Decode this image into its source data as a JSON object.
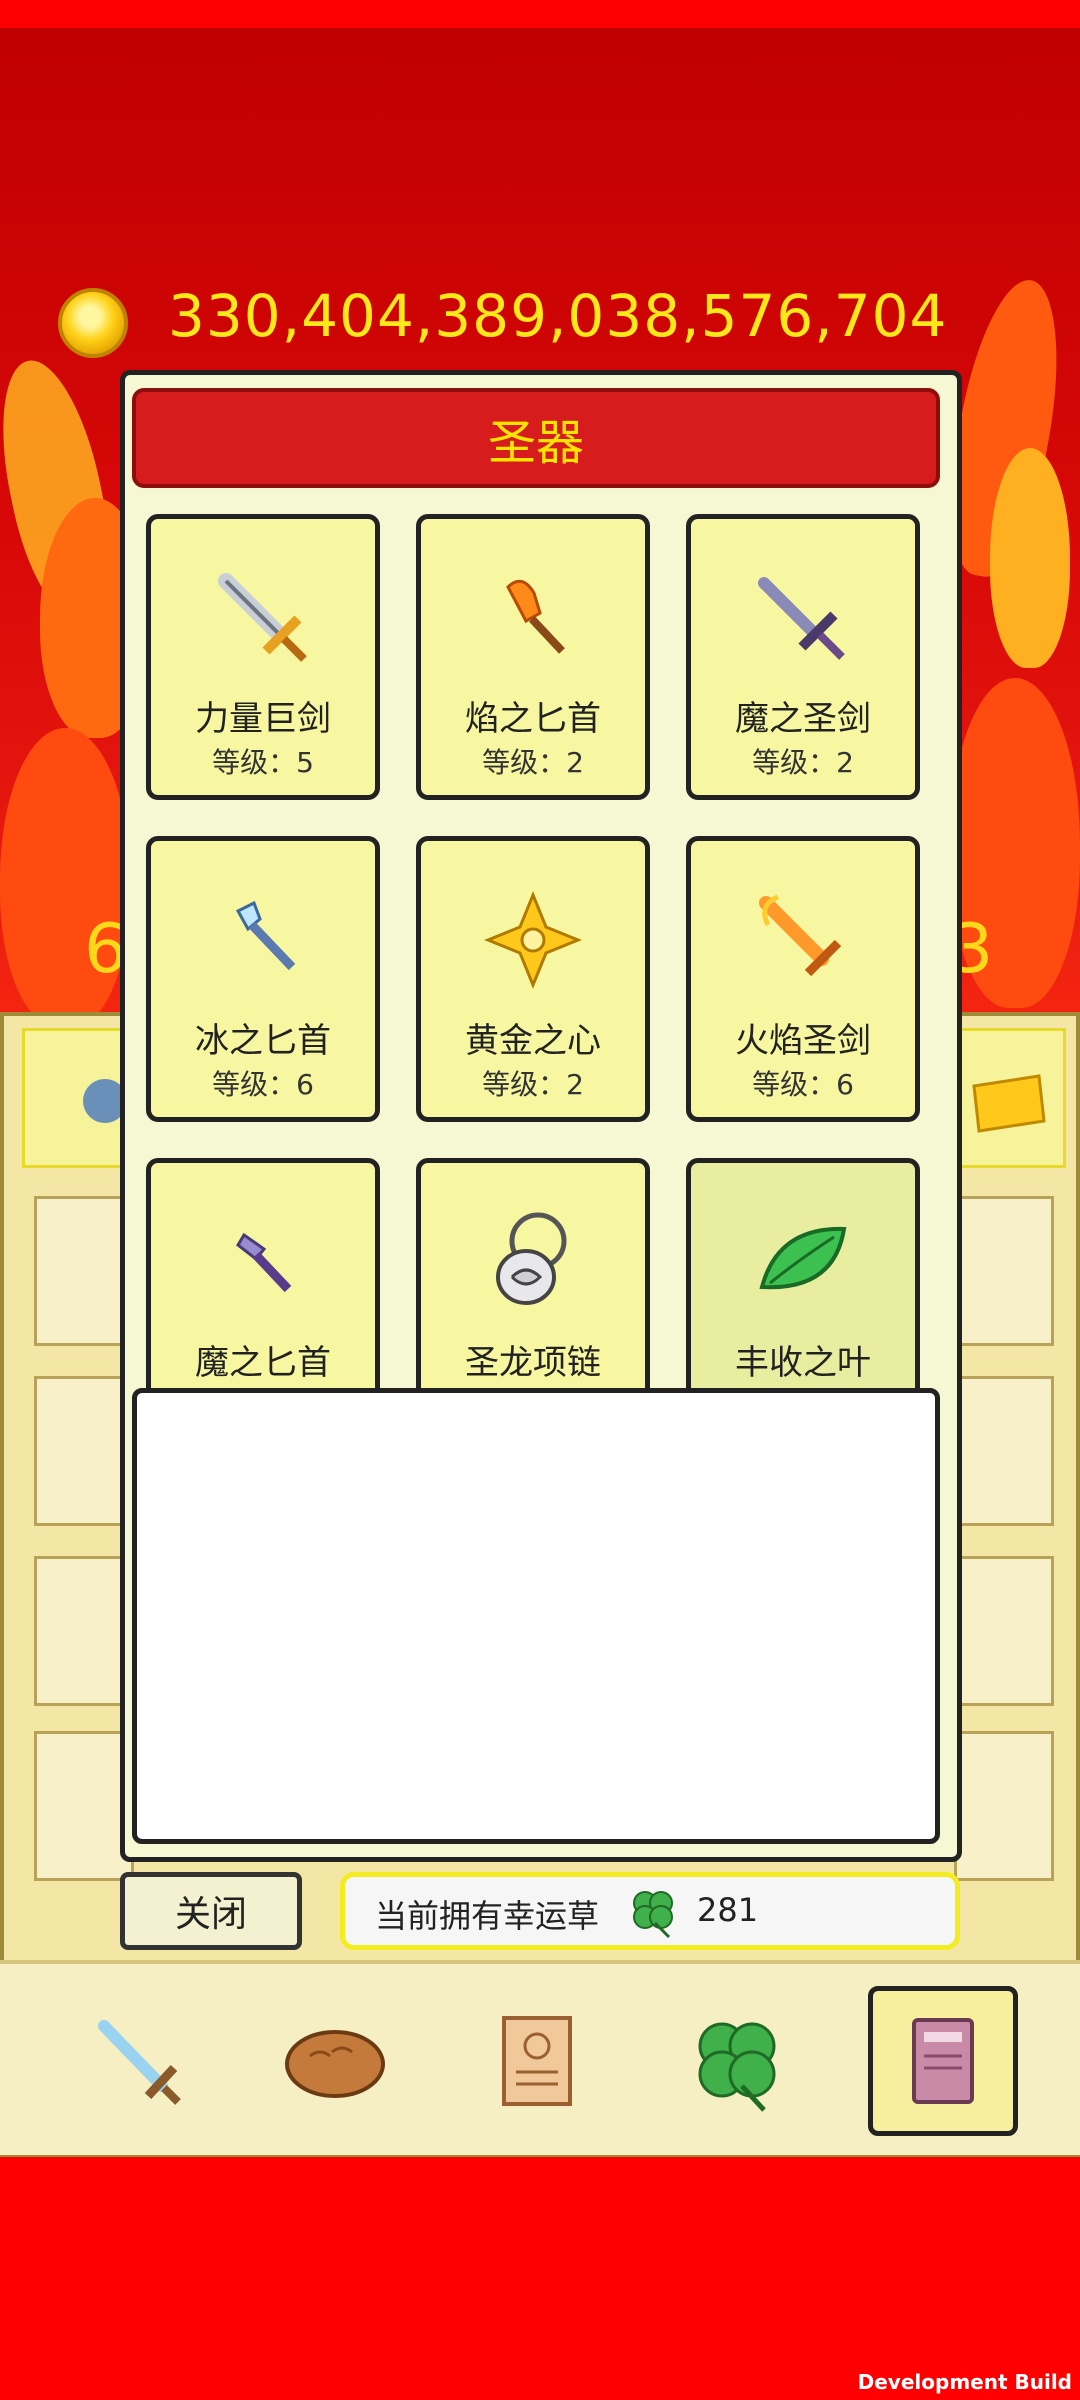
{
  "hud": {
    "gold_amount": "330,404,389,038,576,704",
    "left_number": "6",
    "right_number": "3"
  },
  "dialog": {
    "title": "圣器",
    "artifacts": [
      {
        "name": "力量巨剑",
        "level": "等级：5",
        "icon": "great-sword-icon"
      },
      {
        "name": "焰之匕首",
        "level": "等级：2",
        "icon": "flame-dagger-icon"
      },
      {
        "name": "魔之圣剑",
        "level": "等级：2",
        "icon": "demon-holy-sword-icon"
      },
      {
        "name": "冰之匕首",
        "level": "等级：6",
        "icon": "ice-dagger-icon"
      },
      {
        "name": "黄金之心",
        "level": "等级：2",
        "icon": "golden-heart-icon"
      },
      {
        "name": "火焰圣剑",
        "level": "等级：6",
        "icon": "fire-holy-sword-icon"
      },
      {
        "name": "魔之匕首",
        "level": "",
        "icon": "demon-dagger-icon"
      },
      {
        "name": "圣龙项链",
        "level": "",
        "icon": "dragon-necklace-icon"
      },
      {
        "name": "丰收之叶",
        "level": "",
        "icon": "harvest-leaf-icon"
      }
    ],
    "close_label": "关闭",
    "clover_label": "当前拥有幸运草",
    "clover_count": "281"
  },
  "nav": {
    "items": [
      {
        "icon": "sword-icon"
      },
      {
        "icon": "bread-icon"
      },
      {
        "icon": "scroll-icon"
      },
      {
        "icon": "clover-icon"
      },
      {
        "icon": "book-icon",
        "active": true
      }
    ]
  },
  "footer": {
    "build_label": "Development Build"
  },
  "colors": {
    "title_bar": "#d61c1c",
    "title_text": "#ffe400",
    "card_bg": "#f7f7a2",
    "gold_text": "#ffe81a"
  }
}
